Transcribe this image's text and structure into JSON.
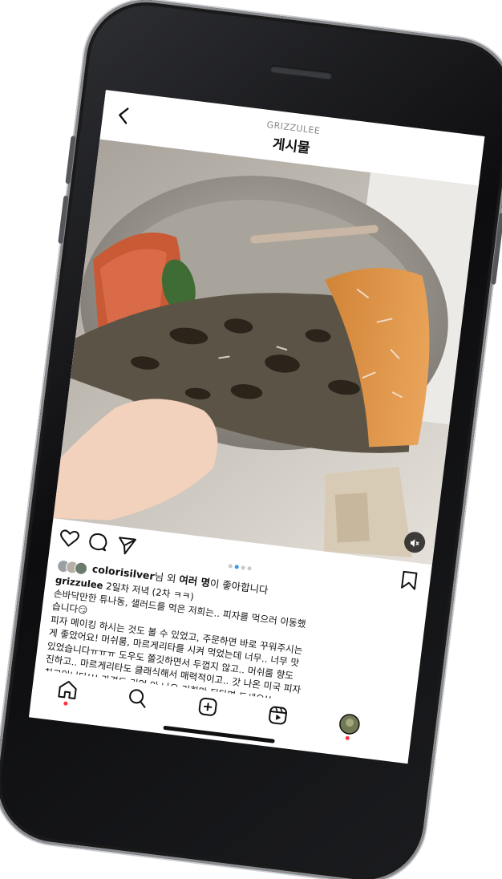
{
  "header": {
    "username": "GRIZZULEE",
    "title": "게시물",
    "back_icon": "chevron-left-icon"
  },
  "photo": {
    "description_icon": "pizza-photo",
    "sound_icon": "speaker-muted-icon"
  },
  "actions": {
    "like_icon": "heart-icon",
    "comment_icon": "comment-icon",
    "share_icon": "send-icon",
    "save_icon": "bookmark-icon",
    "carousel_count": 4,
    "carousel_active": 1,
    "accent_color": "#3897f0"
  },
  "likes": {
    "user": "colorisilver",
    "text_mid": "님 외 ",
    "others": "여러 명",
    "text_end": "이 좋아합니다"
  },
  "caption": {
    "author": "grizzulee",
    "lines": [
      " 2일차 저녁 (2차 ㅋㅋ)",
      "손바닥만한 튜나동, 샐러드를 먹은 저희는.. 피자를 먹으러 이동했",
      "습니다😏",
      "피자 메이킹 하시는 것도 볼 수 있었고, 주문하면 바로 꾸워주시는",
      "게 좋았어요! 머쉬룸, 마르게리타를 시켜 먹었는데 너무.. 너무 맛",
      "있었습니다ㅠㅠㅠ 도우도 쫄깃하면서 두껍지 않고.. 머쉬룸 향도",
      "진하고.. 마르게리타도 클래식해서 매력적이고.. 갓 나온 미국 피자",
      "최고입니다!!! 가격도 기억 안 나요 기회만 된다면 드세요!!"
    ]
  },
  "bottom_nav": {
    "items": [
      "home-icon",
      "search-icon",
      "create-post-icon",
      "reels-icon",
      "profile-avatar"
    ],
    "notification_color": "#ff3040"
  }
}
